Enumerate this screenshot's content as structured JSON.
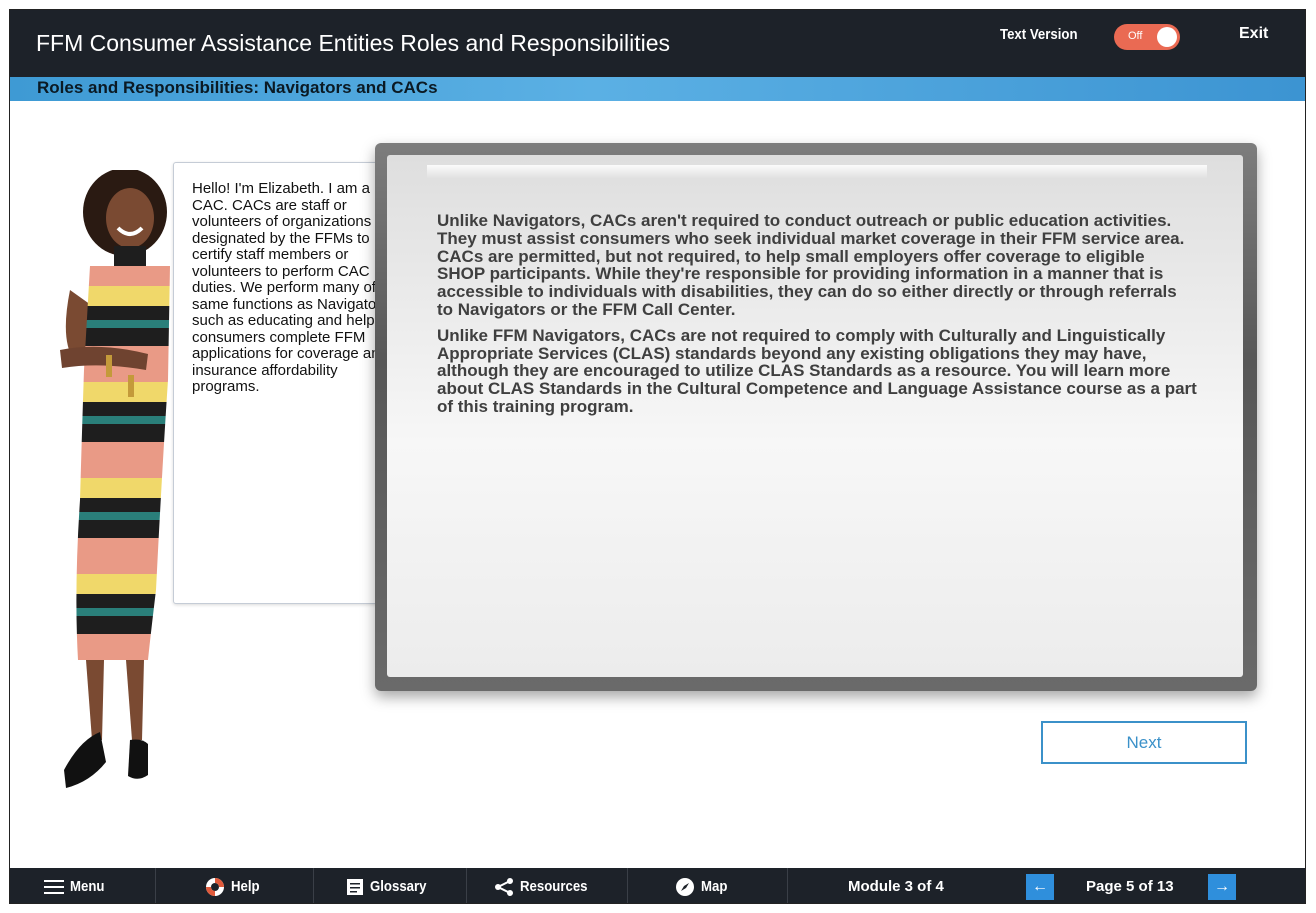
{
  "header": {
    "title": "FFM Consumer Assistance Entities Roles and Responsibilities",
    "text_version_label": "Text Version",
    "toggle_state": "Off",
    "exit_label": "Exit"
  },
  "subheader": {
    "title": "Roles and Responsibilities: Navigators and CACs"
  },
  "speech_bubble": {
    "text": "Hello! I'm Elizabeth. I am a CAC. CACs are staff or volunteers of organizations designated by the FFMs to certify staff members or volunteers to perform CAC duties. We perform many of the same functions as Navigators, such as educating and helping consumers complete FFM applications for coverage and insurance affordability programs."
  },
  "whiteboard": {
    "paragraph_1": "Unlike Navigators, CACs aren't required to conduct outreach or public education activities. They must assist consumers who seek individual market coverage in their FFM service area. CACs are permitted, but not required, to help small employers offer coverage to eligible SHOP participants. While they're responsible for providing information in a manner that is accessible to individuals with disabilities, they can do so either directly or through referrals to Navigators or the FFM Call Center.",
    "paragraph_2": "Unlike FFM Navigators, CACs are not required to comply with Culturally and Linguistically Appropriate Services (CLAS) standards beyond any existing obligations they may have, although they are encouraged to utilize CLAS Standards as a resource. You will learn more about CLAS Standards in the Cultural Competence and Language Assistance course as a part of this training program."
  },
  "next_button": {
    "label": "Next"
  },
  "footer": {
    "menu_label": "Menu",
    "help_label": "Help",
    "glossary_label": "Glossary",
    "resources_label": "Resources",
    "map_label": "Map",
    "module_text": "Module 3 of 4",
    "page_text": "Page 5 of 13"
  },
  "colors": {
    "header_bg": "#1d2229",
    "subheader_blue": "#4aa3dc",
    "toggle_off": "#ea6a53",
    "accent_blue": "#3b91c9",
    "nav_arrow_blue": "#2f8fdc"
  },
  "icons": [
    "hamburger-icon",
    "lifebuoy-icon",
    "glossary-book-icon",
    "share-icon",
    "compass-icon",
    "arrow-left-icon",
    "arrow-right-icon"
  ]
}
